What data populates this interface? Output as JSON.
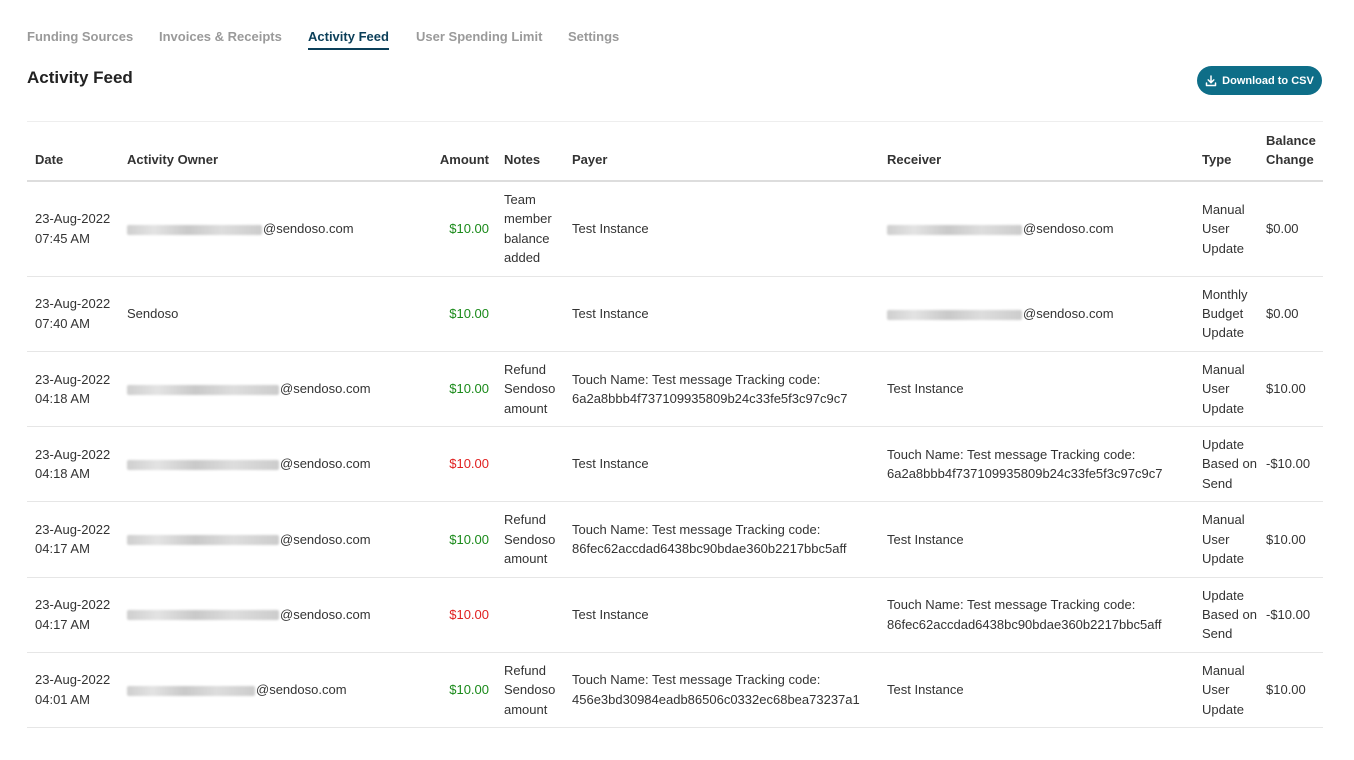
{
  "tabs": [
    {
      "label": "Funding Sources"
    },
    {
      "label": "Invoices & Receipts"
    },
    {
      "label": "Activity Feed"
    },
    {
      "label": "User Spending Limit"
    },
    {
      "label": "Settings"
    }
  ],
  "page_title": "Activity Feed",
  "download_button": {
    "label": "Download to CSV",
    "icon": "download-icon",
    "color": "#0e6e88"
  },
  "colors": {
    "positive_amount": "#1a8a1a",
    "negative_amount": "#e02020",
    "active_tab": "#0b3f59"
  },
  "table": {
    "headers": {
      "date": "Date",
      "owner": "Activity Owner",
      "amount": "Amount",
      "notes": "Notes",
      "payer": "Payer",
      "receiver": "Receiver",
      "type": "Type",
      "balance_change": "Balance Change"
    },
    "rows": [
      {
        "date": "23-Aug-2022 07:45 AM",
        "owner": "@sendoso.com",
        "amount": "$10.00",
        "notes": "Team member balance added",
        "payer": "Test Instance",
        "receiver": "@sendoso.com",
        "type": "Manual User Update",
        "balance_change": "$0.00"
      },
      {
        "date": "23-Aug-2022 07:40 AM",
        "owner": "Sendoso",
        "amount": "$10.00",
        "notes": "",
        "payer": "Test Instance",
        "receiver": "@sendoso.com",
        "type": "Monthly Budget Update",
        "balance_change": "$0.00"
      },
      {
        "date": "23-Aug-2022 04:18 AM",
        "owner": "@sendoso.com",
        "amount": "$10.00",
        "notes": "Refund Sendoso amount",
        "payer": "Touch Name: Test message Tracking code: 6a2a8bbb4f737109935809b24c33fe5f3c97c9c7",
        "receiver": "Test Instance",
        "type": "Manual User Update",
        "balance_change": "$10.00"
      },
      {
        "date": "23-Aug-2022 04:18 AM",
        "owner": "@sendoso.com",
        "amount": "$10.00",
        "notes": "",
        "payer": "Test Instance",
        "receiver": "Touch Name: Test message Tracking code: 6a2a8bbb4f737109935809b24c33fe5f3c97c9c7",
        "type": "Update Based on Send",
        "balance_change": "-$10.00"
      },
      {
        "date": "23-Aug-2022 04:17 AM",
        "owner": "@sendoso.com",
        "amount": "$10.00",
        "notes": "Refund Sendoso amount",
        "payer": "Touch Name: Test message Tracking code: 86fec62accdad6438bc90bdae360b2217bbc5aff",
        "receiver": "Test Instance",
        "type": "Manual User Update",
        "balance_change": "$10.00"
      },
      {
        "date": "23-Aug-2022 04:17 AM",
        "owner": "@sendoso.com",
        "amount": "$10.00",
        "notes": "",
        "payer": "Test Instance",
        "receiver": "Touch Name: Test message Tracking code: 86fec62accdad6438bc90bdae360b2217bbc5aff",
        "type": "Update Based on Send",
        "balance_change": "-$10.00"
      },
      {
        "date": "23-Aug-2022 04:01 AM",
        "owner": "@sendoso.com",
        "amount": "$10.00",
        "notes": "Refund Sendoso amount",
        "payer": "Touch Name: Test message Tracking code: 456e3bd30984eadb86506c0332ec68bea73237a1",
        "receiver": "Test Instance",
        "type": "Manual User Update",
        "balance_change": "$10.00"
      }
    ]
  }
}
